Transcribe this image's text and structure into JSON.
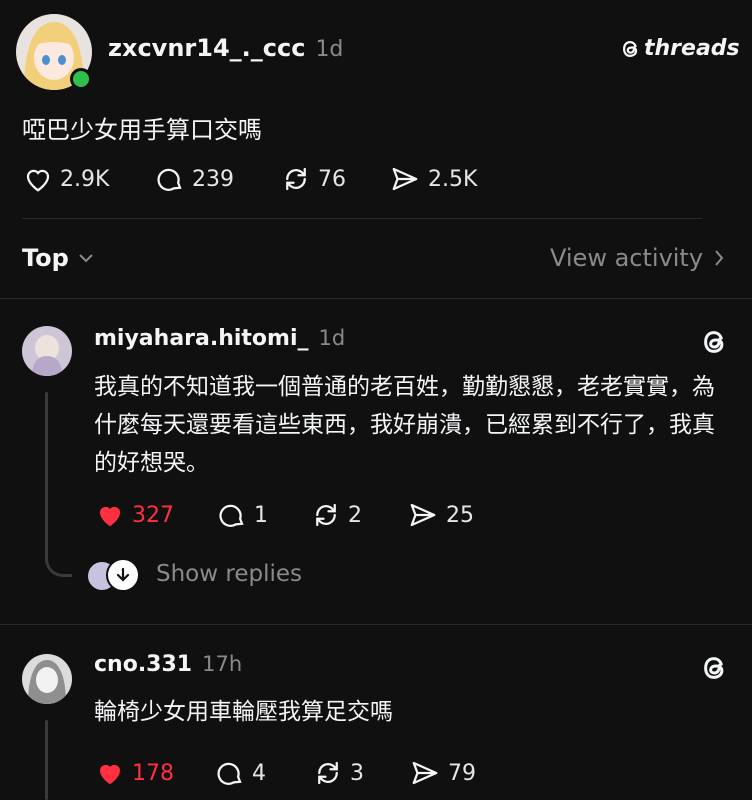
{
  "brand": "threads",
  "post": {
    "username": "zxcvnr14_._ccc",
    "time": "1d",
    "text": "啞巴少女用手算口交嗎",
    "likes": "2.9K",
    "comments": "239",
    "reposts": "76",
    "shares": "2.5K"
  },
  "sort": {
    "label": "Top",
    "view_activity": "View activity"
  },
  "replies": [
    {
      "username": "miyahara.hitomi_",
      "time": "1d",
      "text": "我真的不知道我一個普通的老百姓，勤勤懇懇，老老實實，為什麼每天還要看這些東西，我好崩潰，已經累到不行了，我真的好想哭。",
      "likes": "327",
      "comments": "1",
      "reposts": "2",
      "shares": "25",
      "show_replies": "Show replies"
    },
    {
      "username": "cno.331",
      "time": "17h",
      "text": "輪椅少女用車輪壓我算足交嗎",
      "likes": "178",
      "comments": "4",
      "reposts": "3",
      "shares": "79"
    }
  ],
  "colors": {
    "background": "#101010",
    "liked": "#ff3040",
    "online": "#2fbf4a"
  }
}
